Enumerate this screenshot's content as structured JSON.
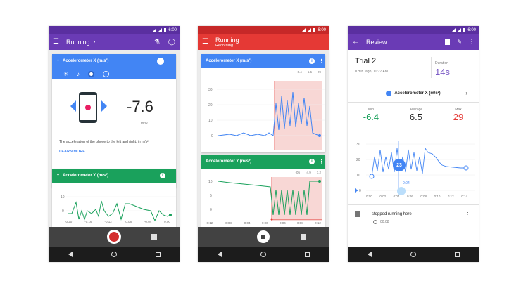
{
  "status": {
    "time": "6:00"
  },
  "colors": {
    "purple": "#6a3bb5",
    "blue": "#4285f4",
    "green": "#1aa15c",
    "red": "#e53935",
    "pink_fill": "#f8d7d5",
    "record": "#d32f2f"
  },
  "phone1": {
    "title": "Running",
    "icons": [
      "menu-icon",
      "flask-icon",
      "add-note-icon"
    ],
    "card1": {
      "title": "Accelerometer X (m/s²)",
      "value": "-7.6",
      "unit": "m/s²",
      "description": "The acceleration of the phone to the left and right, in m/s²",
      "learn_more": "LEARN MORE"
    },
    "card2": {
      "title": "Accelerometer Y (m/s²)",
      "y_ticks": [
        "10",
        "0"
      ],
      "x_ticks": [
        "-0:20",
        "-0:16",
        "-0:12",
        "-0:08",
        "-0:04",
        "0:00"
      ]
    }
  },
  "phone2": {
    "title": "Running",
    "subtitle": "Recording...",
    "card1": {
      "title": "Accelerometer X (m/s²)",
      "stats": [
        "-6.4",
        "6.5",
        "29"
      ],
      "y_ticks": [
        "30",
        "20",
        "10",
        "0"
      ]
    },
    "card2": {
      "title": "Accelerometer Y (m/s²)",
      "stats": [
        "-05",
        "-4.9",
        "7.2"
      ],
      "y_ticks": [
        "10",
        "5",
        "0"
      ],
      "x_ticks": [
        "-0:12",
        "-0:08",
        "-0:04",
        "0:00",
        "0:04",
        "0:08",
        "0:12"
      ]
    }
  },
  "phone3": {
    "title": "Review",
    "trial": "Trial 2",
    "time_ago": "0 min. ago, 11:27 AM",
    "duration_label": "Duration",
    "duration": "14s",
    "sensor": "Accelerometer X (m/s²)",
    "min_label": "Min",
    "min": "-6.4",
    "avg_label": "Average",
    "avg": "6.5",
    "max_label": "Max",
    "max": "29",
    "marker": "23",
    "scrub_time": "0:04",
    "y_ticks": [
      "30",
      "20",
      "10",
      "0"
    ],
    "x_ticks": [
      "0:00",
      "0:02",
      "0:04",
      "0:06",
      "0:08",
      "0:10",
      "0:12",
      "0:14"
    ],
    "note": "stopped running here",
    "note_time": "00:08"
  }
}
